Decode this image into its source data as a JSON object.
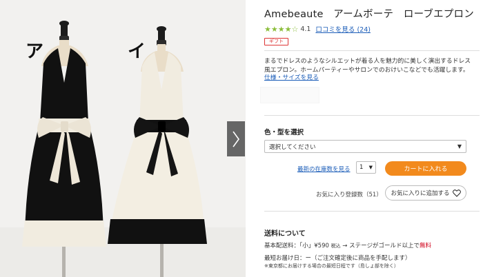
{
  "gallery": {
    "label_a": "ア",
    "label_i": "イ",
    "next_icon": "chevron-right-icon"
  },
  "product": {
    "title": "Amebeaute　アームボーテ　ローブエプロン",
    "stars": "★★★★☆",
    "rating": "4.1",
    "review_link": "口コミを見る (24)",
    "gift_badge": "ギフト",
    "description": "まるでドレスのようなシルエットが着る人を魅力的に美しく演出するドレス風エプロン。ホームパーティーやサロンでのおけいこなどでも活躍します。",
    "size_link": "仕様・サイズを見る"
  },
  "purchase": {
    "select_heading": "色・型を選択",
    "select_value": "選択してください",
    "stock_link": "最新の在庫数を見る",
    "quantity": "1",
    "cart_button": "カートに入れる",
    "fav_count": "お気に入り登録数（51）",
    "fav_button": "お気に入りに追加する",
    "fav_icon": "heart-icon"
  },
  "shipping": {
    "heading": "送料について",
    "line1_prefix": "基本配送料：「小」¥590",
    "line1_small": "税込",
    "line1_mid": "→ ステージがゴールド以上で",
    "line1_red": "無料",
    "line2": "最短お届け日：ー（ご注文確定後に商品を手配します）",
    "note": "※東京都にお届けする場合の最短日程です（島しょ部を除く）"
  },
  "colors": {
    "accent_orange": "#f28a1d",
    "star_green": "#8bbd3a",
    "link_blue": "#1a5cb8",
    "sale_red": "#d0021b"
  }
}
